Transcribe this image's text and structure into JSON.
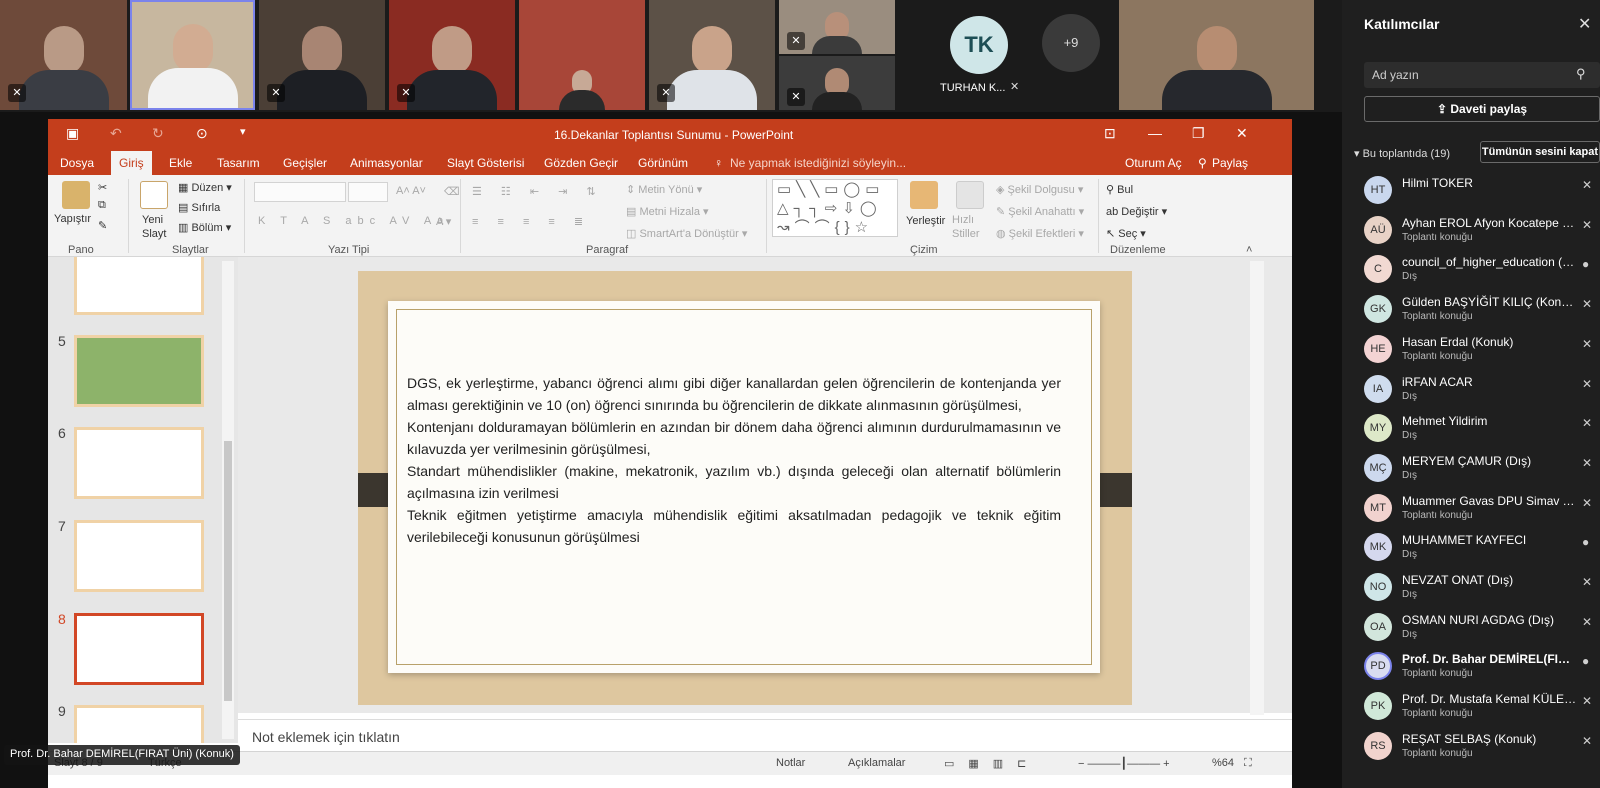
{
  "video_strip": {
    "tk_initials": "TK",
    "tk_name": "TURHAN K...",
    "more_count": "+9"
  },
  "ppt": {
    "title": "16.Dekanlar Toplantısı Sunumu - PowerPoint",
    "tabs": [
      "Dosya",
      "Giriş",
      "Ekle",
      "Tasarım",
      "Geçişler",
      "Animasyonlar",
      "Slayt Gösterisi",
      "Gözden Geçir",
      "Görünüm"
    ],
    "tell_me": "Ne yapmak istediğinizi söyleyin...",
    "sign_in": "Oturum Aç",
    "share": "Paylaş",
    "ribbon": {
      "paste": "Yapıştır",
      "new_slide": "Yeni\nSlayt",
      "duzen": "Düzen",
      "sifirla": "Sıfırla",
      "bolum": "Bölüm",
      "metin_yonu": "Metin Yönü",
      "metni_hizala": "Metni Hizala",
      "smartart": "SmartArt'a Dönüştür",
      "yerlestir": "Yerleştir",
      "hizli_stiller": "Hızlı\nStiller",
      "sekil_dolgusu": "Şekil Dolgusu",
      "sekil_anahatti": "Şekil Anahattı",
      "sekil_efektleri": "Şekil Efektleri",
      "bul": "Bul",
      "degistir": "Değiştir",
      "sec": "Seç",
      "groups": [
        "Pano",
        "Slaytlar",
        "Yazı Tipi",
        "Paragraf",
        "Çizim",
        "Düzenleme"
      ]
    },
    "thumb_numbers": [
      "5",
      "6",
      "7",
      "8",
      "9"
    ],
    "slide_paragraphs": [
      "DGS, ek yerleştirme, yabancı öğrenci alımı gibi diğer kanallardan gelen öğrencilerin de kontenjanda yer alması gerektiğinin ve 10 (on) öğrenci sınırında bu öğrencilerin de dikkate alınmasının görüşülmesi,",
      "Kontenjanı dolduramayan bölümlerin en azından bir dönem daha öğrenci alımının durdurulmamasının ve kılavuzda yer verilmesinin görüşülmesi,",
      "Standart mühendislikler (makine, mekatronik, yazılım vb.) dışında geleceği olan alternatif bölümlerin açılmasına izin verilmesi",
      "Teknik eğitmen yetiştirme amacıyla mühendislik eğitimi aksatılmadan pedagojik ve teknik eğitim verilebileceği konusunun görüşülmesi"
    ],
    "notes_placeholder": "Not eklemek için tıklatın",
    "status": {
      "slide": "Slayt 8 / 9",
      "lang": "Türkçe",
      "notes": "Notlar",
      "comments": "Açıklamalar",
      "zoom": "%64"
    }
  },
  "speaker_badge": "Prof. Dr. Bahar DEMİREL(FIRAT Üni) (Konuk)",
  "panel": {
    "title": "Katılımcılar",
    "search_placeholder": "Ad yazın",
    "invite": "Daveti paylaş",
    "in_meeting": "Bu toplantıda (19)",
    "mute_all": "Tümünün sesini kapat",
    "participants": [
      {
        "initials": "HT",
        "name": "Hilmi TOKER",
        "role": "",
        "color": "#c9d7ee",
        "bold": false
      },
      {
        "initials": "AÜ",
        "name": "Ayhan EROL Afyon Kocatepe Ün...",
        "role": "Toplantı konuğu",
        "color": "#e8d2c6",
        "bold": false
      },
      {
        "initials": "C",
        "name": "council_of_higher_education (Dış)",
        "role": "Dış",
        "color": "#f1d9d2",
        "bold": false
      },
      {
        "initials": "GK",
        "name": "Gülden BAŞYİĞİT KILIÇ (Konuk)",
        "role": "Toplantı konuğu",
        "color": "#cfe6e1",
        "bold": false
      },
      {
        "initials": "HE",
        "name": "Hasan Erdal (Konuk)",
        "role": "Toplantı konuğu",
        "color": "#f3d3d3",
        "bold": false
      },
      {
        "initials": "IA",
        "name": "iRFAN ACAR",
        "role": "Dış",
        "color": "#cfdcee",
        "bold": false
      },
      {
        "initials": "MY",
        "name": "Mehmet Yildirim",
        "role": "Dış",
        "color": "#dde8c8",
        "bold": false
      },
      {
        "initials": "MÇ",
        "name": "MERYEM ÇAMUR (Dış)",
        "role": "Dış",
        "color": "#cdd9ee",
        "bold": false
      },
      {
        "initials": "MT",
        "name": "Muammer Gavas DPU Simav T.F....",
        "role": "Toplantı konuğu",
        "color": "#f1d2ce",
        "bold": false
      },
      {
        "initials": "MK",
        "name": "MUHAMMET KAYFECI",
        "role": "Dış",
        "color": "#d5d8ee",
        "bold": false
      },
      {
        "initials": "NO",
        "name": "NEVZAT ONAT (Dış)",
        "role": "Dış",
        "color": "#cfe6e8",
        "bold": false
      },
      {
        "initials": "OA",
        "name": "OSMAN NURI AGDAG (Dış)",
        "role": "Dış",
        "color": "#d2e6dc",
        "bold": false
      },
      {
        "initials": "PD",
        "name": "Prof. Dr. Bahar DEMİREL(FIRAT ...",
        "role": "Toplantı konuğu",
        "color": "#d9dcf0",
        "bold": true
      },
      {
        "initials": "PK",
        "name": "Prof. Dr. Mustafa Kemal KÜLEKC...",
        "role": "Toplantı konuğu",
        "color": "#d0e8d8",
        "bold": false
      },
      {
        "initials": "RS",
        "name": "REŞAT SELBAŞ (Konuk)",
        "role": "Toplantı konuğu",
        "color": "#f1d3cd",
        "bold": false
      }
    ]
  }
}
